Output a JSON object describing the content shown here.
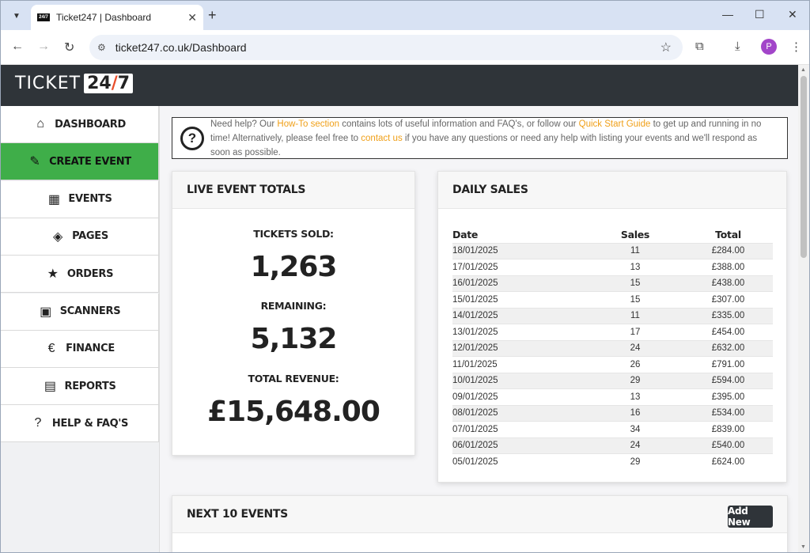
{
  "browser": {
    "tab_title": "Ticket247 | Dashboard",
    "favicon_text": "24/7",
    "url": "ticket247.co.uk/Dashboard",
    "profile_initial": "P"
  },
  "logo": {
    "word": "TICKET",
    "box_pre": "24",
    "box_slash": "/",
    "box_post": "7"
  },
  "sidebar": {
    "items": [
      {
        "label": "DASHBOARD",
        "icon": "home-icon",
        "glyph": "⌂",
        "active": false
      },
      {
        "label": "CREATE EVENT",
        "icon": "pencil-icon",
        "glyph": "✎",
        "active": true
      },
      {
        "label": "EVENTS",
        "icon": "calendar-icon",
        "glyph": "▦",
        "active": false
      },
      {
        "label": "PAGES",
        "icon": "layers-icon",
        "glyph": "◈",
        "active": false
      },
      {
        "label": "ORDERS",
        "icon": "ticket-icon",
        "glyph": "★",
        "active": false
      },
      {
        "label": "SCANNERS",
        "icon": "qr-code-icon",
        "glyph": "▣",
        "active": false
      },
      {
        "label": "FINANCE",
        "icon": "euro-icon",
        "glyph": "€",
        "active": false
      },
      {
        "label": "REPORTS",
        "icon": "clipboard-icon",
        "glyph": "▤",
        "active": false
      },
      {
        "label": "HELP & FAQ'S",
        "icon": "question-circle-icon",
        "glyph": "?",
        "active": false
      }
    ],
    "active_color": "#3fae49"
  },
  "help": {
    "t1": "Need help? Our ",
    "link1": "How-To section",
    "t2": " contains lots of useful information and FAQ's, or follow our ",
    "link2": "Quick Start Guide",
    "t3": " to get up and running in no time! Alternatively, please feel free to ",
    "link3": "contact us",
    "t4": " if you have any questions or need any help with listing your events and we'll respond as soon as possible."
  },
  "totals": {
    "title": "LIVE EVENT TOTALS",
    "tickets_label": "TICKETS SOLD:",
    "tickets_value": "1,263",
    "remaining_label": "REMAINING:",
    "remaining_value": "5,132",
    "revenue_label": "TOTAL REVENUE:",
    "revenue_value": "£15,648.00"
  },
  "daily_sales": {
    "title": "DAILY SALES",
    "headers": [
      "Date",
      "Sales",
      "Total"
    ],
    "rows": [
      [
        "18/01/2025",
        "11",
        "£284.00"
      ],
      [
        "17/01/2025",
        "13",
        "£388.00"
      ],
      [
        "16/01/2025",
        "15",
        "£438.00"
      ],
      [
        "15/01/2025",
        "15",
        "£307.00"
      ],
      [
        "14/01/2025",
        "11",
        "£335.00"
      ],
      [
        "13/01/2025",
        "17",
        "£454.00"
      ],
      [
        "12/01/2025",
        "24",
        "£632.00"
      ],
      [
        "11/01/2025",
        "26",
        "£791.00"
      ],
      [
        "10/01/2025",
        "29",
        "£594.00"
      ],
      [
        "09/01/2025",
        "13",
        "£395.00"
      ],
      [
        "08/01/2025",
        "16",
        "£534.00"
      ],
      [
        "07/01/2025",
        "34",
        "£839.00"
      ],
      [
        "06/01/2025",
        "24",
        "£540.00"
      ],
      [
        "05/01/2025",
        "29",
        "£624.00"
      ]
    ]
  },
  "next_events": {
    "title": "NEXT 10 EVENTS",
    "add_label": "Add New"
  }
}
